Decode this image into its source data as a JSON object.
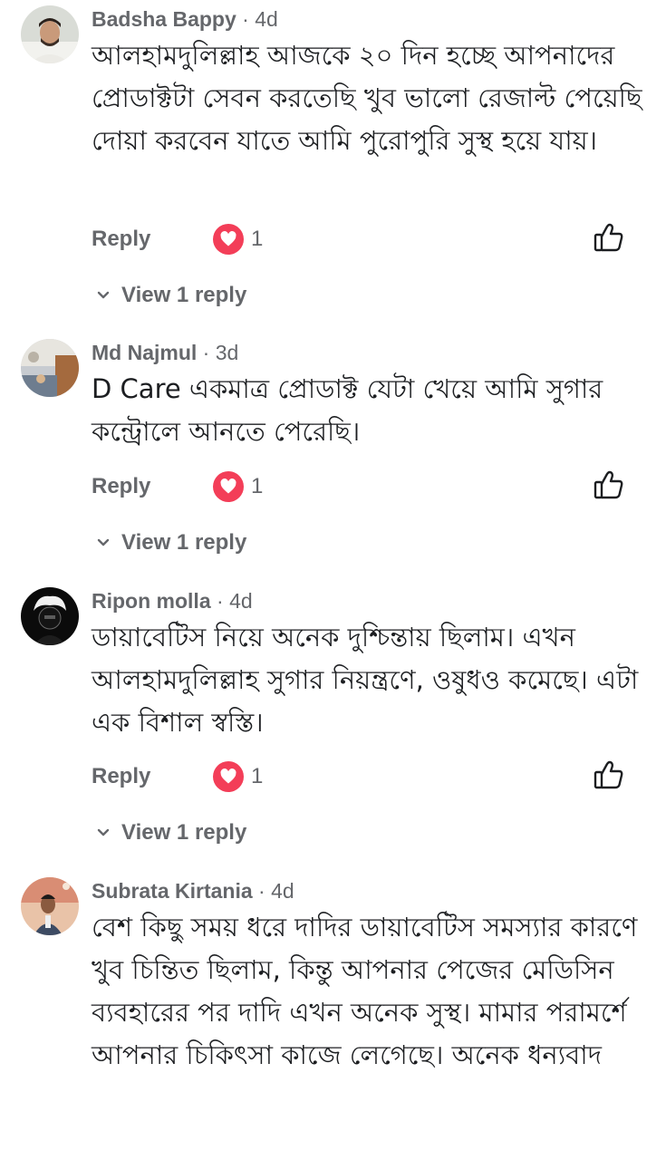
{
  "colors": {
    "text": "#1c1e21",
    "secondary": "#65676b",
    "reaction_heart": "#f33e58"
  },
  "labels": {
    "reply": "Reply",
    "view_replies": "View 1 reply"
  },
  "comments": [
    {
      "author": "Badsha Bappy",
      "separator": "·",
      "time": "4d",
      "text": "আলহামদুলিল্লাহ আজকে ২০ দিন হচ্ছে আপনাদের প্রোডাক্টটা সেবন করতেছি খুব ভালো রেজাল্ট পেয়েছি দোয়া করবেন যাতে আমি পুরোপুরি সুস্থ হয়ে যায়।",
      "reaction_icon": "heart-icon",
      "reaction_count": "1",
      "view_replies": "View 1 reply"
    },
    {
      "author": "Md Najmul",
      "separator": "·",
      "time": "3d",
      "text": "D Care একমাত্র প্রোডাক্ট যেটা খেয়ে আমি সুগার কন্ট্রোলে আনতে পেরেছি।",
      "reaction_icon": "heart-icon",
      "reaction_count": "1",
      "view_replies": "View 1 reply"
    },
    {
      "author": "Ripon molla",
      "separator": "·",
      "time": "4d",
      "text": "ডায়াবেটিস নিয়ে অনেক দুশ্চিন্তায় ছিলাম। এখন আলহামদুলিল্লাহ সুগার নিয়ন্ত্রণে, ওষুধও কমেছে। এটা এক বিশাল স্বস্তি।",
      "reaction_icon": "heart-icon",
      "reaction_count": "1",
      "view_replies": "View 1 reply"
    },
    {
      "author": "Subrata Kirtania",
      "separator": "·",
      "time": "4d",
      "text": "বেশ কিছু সময় ধরে দাদির ডায়াবেটিস সমস্যার কারণে খুব চিন্তিত ছিলাম, কিন্তু আপনার পেজের মেডিসিন ব্যবহারের পর দাদি এখন অনেক সুস্থ। মামার পরামর্শে আপনার চিকিৎসা কাজে লেগেছে। অনেক ধন্যবাদ"
    }
  ]
}
